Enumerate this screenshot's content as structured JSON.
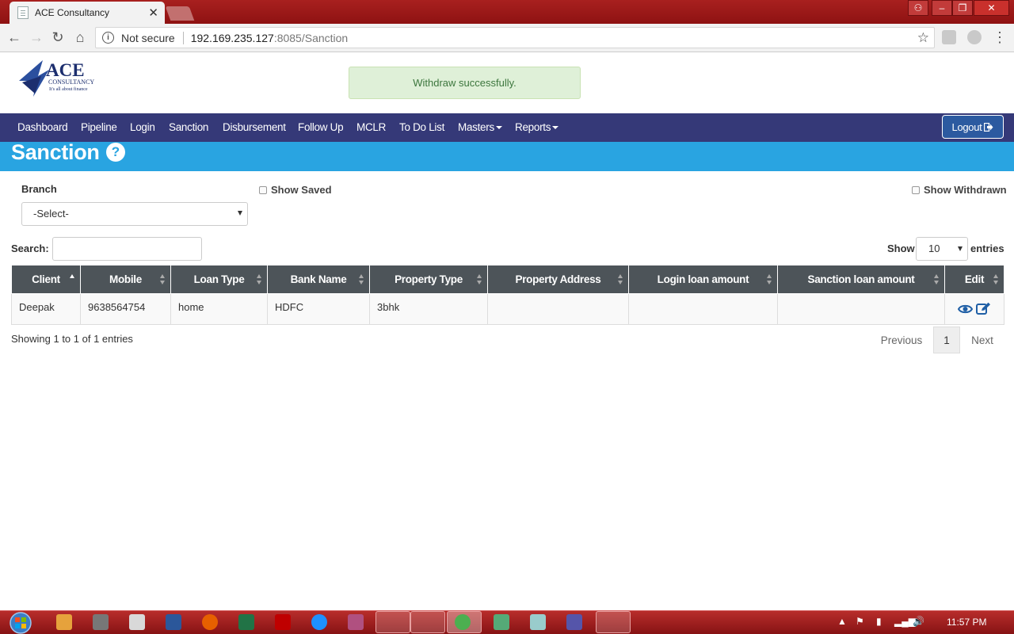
{
  "browser": {
    "tab_title": "ACE Consultancy",
    "not_secure": "Not secure",
    "url_host": "192.169.235.127",
    "url_path": ":8085/Sanction"
  },
  "alert": "Withdraw successfully.",
  "nav": {
    "items": [
      "Dashboard",
      "Pipeline",
      "Login",
      "Sanction",
      "Disbursement",
      "Follow Up",
      "MCLR",
      "To Do List"
    ],
    "masters": "Masters",
    "reports": "Reports",
    "logout": "Logout"
  },
  "logo": {
    "name": "ACE",
    "sub": "CONSULTANCY",
    "tagline": "It's all about finance"
  },
  "page": {
    "title": "Sanction",
    "help": "?",
    "branch_label": "Branch",
    "branch_value": "-Select-",
    "show_saved": "Show Saved",
    "show_withdrawn": "Show Withdrawn",
    "search_label": "Search:",
    "show_label": "Show",
    "page_length": "10",
    "entries_label": "entries"
  },
  "table": {
    "columns": [
      "Client",
      "Mobile",
      "Loan Type",
      "Bank Name",
      "Property Type",
      "Property Address",
      "Login loan amount",
      "Sanction loan amount",
      "Edit"
    ],
    "rows": [
      [
        "Deepak",
        "9638564754",
        "home",
        "HDFC",
        "3bhk",
        "",
        "",
        ""
      ]
    ]
  },
  "footer": {
    "info": "Showing 1 to 1 of 1 entries",
    "previous": "Previous",
    "page": "1",
    "next": "Next"
  },
  "colors": {
    "nav_bg": "#353978",
    "banner_bg": "#29a4e1",
    "table_header_bg": "#4d5459",
    "alert_bg": "#dff0d8"
  },
  "taskbar": {
    "clock": "11:57 PM"
  }
}
